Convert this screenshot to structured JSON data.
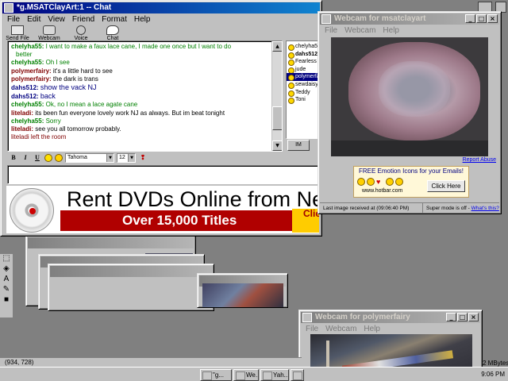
{
  "desktop": {
    "statusbar_coords": "(934, 728)",
    "memory_text": "2 MBytes",
    "clock": "9:06 PM",
    "taskbar_items": [
      "\"g...",
      "We...",
      "Yah...",
      "We..."
    ]
  },
  "chat_window": {
    "title": "*g.MSATClayArt:1 -- Chat",
    "menu": [
      "File",
      "Edit",
      "View",
      "Friend",
      "Format",
      "Help"
    ],
    "toolbar": [
      "Send File",
      "Webcam",
      "Voice",
      "Chat"
    ],
    "messages": [
      {
        "nick": "chelyha55:",
        "text": "I want to make a faux lace cane, I made one once but I want to do",
        "style": "green"
      },
      {
        "nick": "",
        "text": "better",
        "style": "green-cont"
      },
      {
        "nick": "chelyha55:",
        "text": "Oh I see",
        "style": "green"
      },
      {
        "nick": "polymerfairy:",
        "text": "it's a little hard to see",
        "style": "red"
      },
      {
        "nick": "polymerfairy:",
        "text": "the dark is trans",
        "style": "red"
      },
      {
        "nick": "dahs512:",
        "text": "show the vack NJ",
        "style": "blue"
      },
      {
        "nick": "dahs512:",
        "text": "back",
        "style": "blue"
      },
      {
        "nick": "chelyha55:",
        "text": "Ok, no I mean a lace agate cane",
        "style": "green"
      },
      {
        "nick": "liteladi:",
        "text": "its been fun everyone lovely work NJ as always. But im beat tonight",
        "style": "dark"
      },
      {
        "nick": "chelyha55:",
        "text": "Sorry",
        "style": "green"
      },
      {
        "nick": "liteladi:",
        "text": "see you all tomorrow probably.",
        "style": "dark"
      },
      {
        "nick": "",
        "text": "liteladi left the room",
        "style": "leave"
      }
    ],
    "users": [
      "chelyha5",
      "dahs512",
      "Fearless",
      "jude",
      "polymerfa",
      "sewdaisy",
      "Teddy",
      "Toni"
    ],
    "selected_user_index": 4,
    "im_button": "IM",
    "format": {
      "font": "Tahoma",
      "size": "12",
      "bold": "B",
      "italic": "I",
      "underline": "U"
    },
    "ad": {
      "line1": "Rent DVDs Online from Netfl",
      "line2": "Over 15,000 Titles",
      "corner": "Click to t for FF"
    }
  },
  "webcam1": {
    "title": "Webcam for msatclayart",
    "menu": [
      "File",
      "Webcam",
      "Help"
    ],
    "report_abuse": "Report Abuse",
    "emotion_title": "FREE Emotion Icons for your Emails!",
    "emotion_site": "www.hotbar.com",
    "click_here": "Click Here",
    "last_image": "Last image received at (09:06:40 PM)",
    "super_mode": "Super mode is off - ",
    "whats_this": "What's this?"
  },
  "webcam2": {
    "title": "Webcam for polymerfairy",
    "menu": [
      "File",
      "Webcam",
      "Help"
    ]
  }
}
